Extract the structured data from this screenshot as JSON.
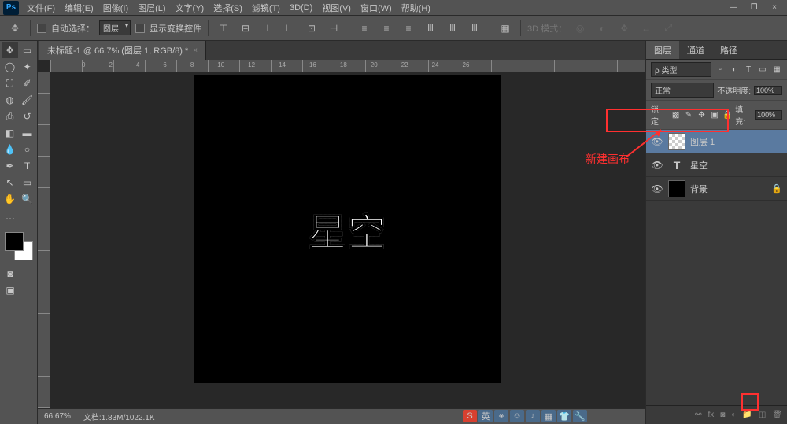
{
  "app": {
    "logo": "Ps"
  },
  "menu": {
    "file": "文件(F)",
    "edit": "编辑(E)",
    "image": "图像(I)",
    "layer": "图层(L)",
    "type": "文字(Y)",
    "select": "选择(S)",
    "filter": "滤镜(T)",
    "threed": "3D(D)",
    "view": "视图(V)",
    "window": "窗口(W)",
    "help": "帮助(H)"
  },
  "win": {
    "min": "—",
    "max": "❐",
    "close": "×"
  },
  "options": {
    "auto_select": "自动选择：",
    "layer_dd": "图层",
    "show_transform": "显示变换控件",
    "mode3d": "3D 模式："
  },
  "document": {
    "tab": "未标题-1 @ 66.7% (图层 1, RGB/8) *",
    "close": "×",
    "canvas_text": "星空"
  },
  "ruler": {
    "nums": [
      "0",
      "2",
      "4",
      "6",
      "8",
      "10",
      "12",
      "14",
      "16",
      "18",
      "20",
      "22",
      "24",
      "26"
    ]
  },
  "status": {
    "zoom": "66.67%",
    "info": "文档:1.83M/1022.1K"
  },
  "panels": {
    "tabs": {
      "layers": "图层",
      "channels": "通道",
      "paths": "路径"
    },
    "filter_dd": "ρ 类型",
    "blend": "正常",
    "opacity_label": "不透明度:",
    "opacity_val": "100%",
    "lock_label": "锁定:",
    "fill_label": "填充:",
    "fill_val": "100%",
    "layers": [
      {
        "name": "图层 1",
        "thumb": "checker",
        "sel": true
      },
      {
        "name": "星空",
        "thumb": "text"
      },
      {
        "name": "背景",
        "thumb": "black",
        "locked": true
      }
    ]
  },
  "annotation": {
    "text": "新建画布"
  },
  "taskbar": {
    "label": "英"
  }
}
